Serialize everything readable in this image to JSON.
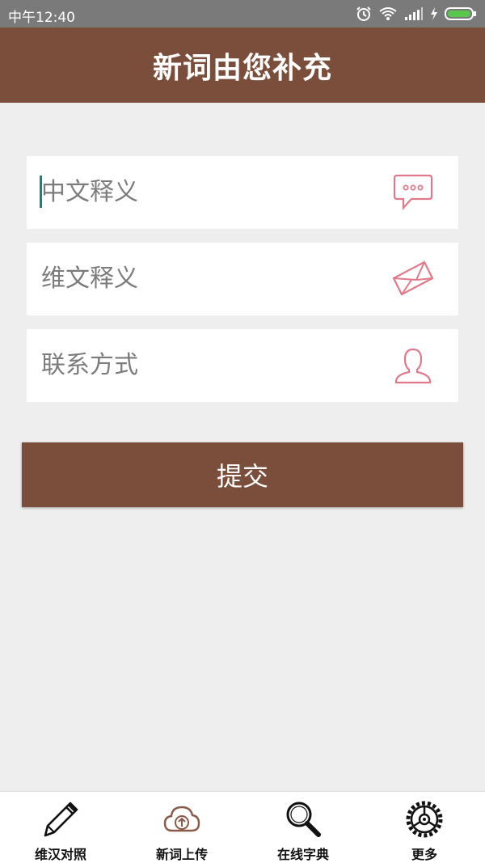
{
  "status_bar": {
    "time": "中午12:40"
  },
  "header": {
    "title": "新词由您补充"
  },
  "form": {
    "fields": [
      {
        "placeholder": "中文释义",
        "icon": "chat-bubble-icon"
      },
      {
        "placeholder": "维文释义",
        "icon": "envelope-icon"
      },
      {
        "placeholder": "联系方式",
        "icon": "person-icon"
      }
    ],
    "submit_label": "提交"
  },
  "bottom_nav": {
    "items": [
      {
        "label": "维汉对照",
        "icon": "pencil-icon"
      },
      {
        "label": "新词上传",
        "icon": "cloud-upload-icon"
      },
      {
        "label": "在线字典",
        "icon": "magnifier-icon"
      },
      {
        "label": "更多",
        "icon": "gear-icon"
      }
    ]
  },
  "colors": {
    "brand": "#7a4e3b",
    "background": "#eeeeee",
    "accent_icon": "#e07a8a",
    "cursor": "#15857a"
  }
}
